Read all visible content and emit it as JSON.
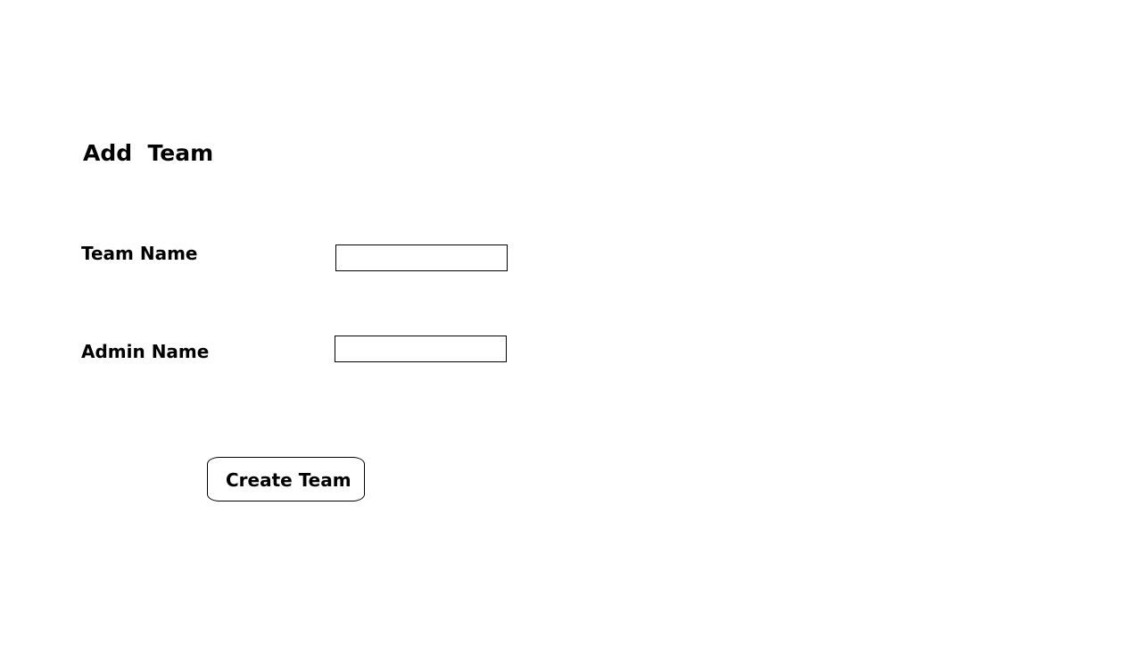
{
  "form": {
    "title": "Add  Team",
    "team_name_label": "Team Name",
    "team_name_value": "",
    "admin_name_label": "Admin Name",
    "admin_name_value": "",
    "submit_label": "Create Team"
  }
}
